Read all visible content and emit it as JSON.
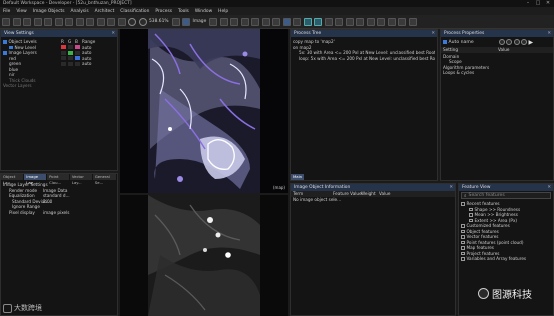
{
  "window": {
    "title": "Default Workspace - Developer - [52u_bnthuzan_PROJECT]",
    "controls": [
      "–",
      "□",
      "✕"
    ]
  },
  "menu": [
    "File",
    "View",
    "Image Objects",
    "Analysis",
    "Architect",
    "Classification",
    "Process",
    "Tools",
    "Window",
    "Help"
  ],
  "toolbar": {
    "zoom": "538.61%",
    "mode": "Image"
  },
  "view_settings": {
    "title": "View Settings",
    "items": [
      "Object Levels",
      "New Level",
      "Image Layers",
      "red",
      "green",
      "blue",
      "nir",
      "Thick Clouds",
      "Vector Layers"
    ],
    "mixing_header": [
      "R",
      "G",
      "B",
      "Range"
    ],
    "layer_rows": [
      {
        "name": "red",
        "range": "auto"
      },
      {
        "name": "green",
        "range": "auto"
      },
      {
        "name": "blue",
        "range": "auto"
      },
      {
        "name": "nir",
        "range": "auto"
      }
    ],
    "colors": {
      "red": "#d9363e",
      "green": "#3bb34a",
      "blue": "#3b6fd9",
      "pink": "#c94a8a"
    }
  },
  "left_bottom": {
    "tabs": [
      "Object Lay...",
      "Image Lay...",
      "Point Clou...",
      "Vector Lay...",
      "General Se..."
    ],
    "section": "Image Layer Settings",
    "props": [
      {
        "k": "Render mode",
        "v": "Image Data"
      },
      {
        "k": "Equalization",
        "v": "standard d..."
      },
      {
        "k": "Standard Deviati...",
        "v": "2.00"
      },
      {
        "k": "Ignore Range",
        "v": ""
      },
      {
        "k": "Pixel display",
        "v": "image pixels"
      }
    ]
  },
  "watermark_left": "大数跨境",
  "process_tree": {
    "title": "Process Tree",
    "lines": [
      "copy map to 'map2'",
      "on map2",
      "5x: 30 with Area <= 200 Pxl at New Level: unclassified best Root",
      "loop: 5x with Area <= 200 Pxl at New Level: unclassified best Root"
    ],
    "tab": "Main"
  },
  "process_props": {
    "title": "Process Properties",
    "mode": "Auto name",
    "col_setting": "Setting",
    "col_value": "Value",
    "items": [
      "Domain",
      "Scope",
      "Algorithm parameters",
      "Loops & cycles"
    ]
  },
  "image_object_info": {
    "title": "Image Object Information",
    "cols": [
      "Term",
      "Feature Value",
      "Weight",
      "Value"
    ],
    "empty": "No image object sele..."
  },
  "feature_view": {
    "title": "Feature View",
    "search": "Search features",
    "items": [
      "Recent features",
      "Shape >> Roundness",
      "Mean >> Brightness",
      "Extent >> Area (Px)",
      "Customized features",
      "Object features",
      "Vector features",
      "Point features (point cloud)",
      "Map features",
      "Project features",
      "Variables and Array features"
    ]
  },
  "viewer": {
    "label": "(map)"
  },
  "watermark_right": "图源科技"
}
